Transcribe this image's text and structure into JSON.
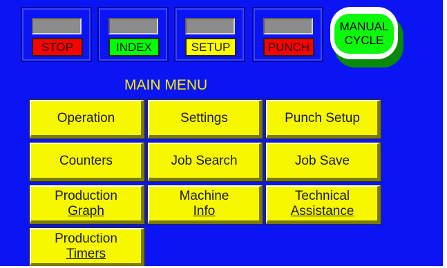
{
  "status": [
    {
      "label": "STOP",
      "color": "#ff0000"
    },
    {
      "label": "INDEX",
      "color": "#00ff00"
    },
    {
      "label": "SETUP",
      "color": "#ffff00"
    },
    {
      "label": "PUNCH",
      "color": "#ff0000"
    }
  ],
  "manual_cycle": {
    "line1": "MANUAL",
    "line2": "CYCLE"
  },
  "menu_title": "MAIN MENU",
  "menu": {
    "operation": "Operation",
    "settings": "Settings",
    "punch_setup": "Punch Setup",
    "counters": "Counters",
    "job_search": "Job Search",
    "job_save": "Job Save",
    "production_graph": {
      "line1": "Production",
      "line2": "Graph"
    },
    "machine_info": {
      "line1": "Machine",
      "line2": "Info"
    },
    "technical_assistance": {
      "line1": "Technical",
      "line2": "Assistance"
    },
    "production_timers": {
      "line1": "Production",
      "line2": "Timers"
    }
  },
  "colors": {
    "background": "#0b14f2",
    "button_yellow": "#f7f700",
    "title_yellow": "#f5f000",
    "manual_green": "#0cf80c"
  }
}
